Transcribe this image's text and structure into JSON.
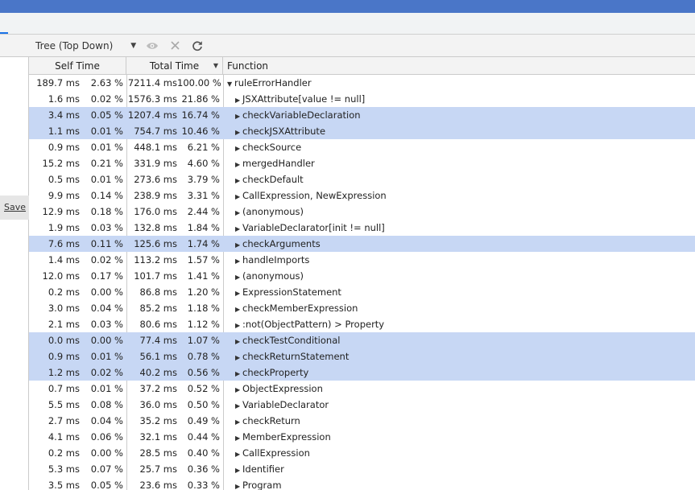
{
  "toolbar": {
    "view_select": "Tree (Top Down)",
    "icons": [
      "dropdown-arrow-icon",
      "eye-icon",
      "close-icon",
      "reload-icon"
    ]
  },
  "left": {
    "save_label": "Save"
  },
  "columns": {
    "self": "Self Time",
    "total": "Total Time",
    "function": "Function"
  },
  "colors": {
    "topbar": "#4a76c8",
    "selection": "#c7d7f4",
    "accent": "#1a73e8"
  },
  "rows": [
    {
      "self_ms": "189.7 ms",
      "self_pct": "2.63 %",
      "total_ms": "7211.4 ms",
      "total_pct": "100.00 %",
      "fn": "ruleErrorHandler",
      "expanded": true,
      "selected": false,
      "level": 0
    },
    {
      "self_ms": "1.6 ms",
      "self_pct": "0.02 %",
      "total_ms": "1576.3 ms",
      "total_pct": "21.86 %",
      "fn": "JSXAttribute[value != null]",
      "expanded": false,
      "selected": false,
      "level": 1
    },
    {
      "self_ms": "3.4 ms",
      "self_pct": "0.05 %",
      "total_ms": "1207.4 ms",
      "total_pct": "16.74 %",
      "fn": "checkVariableDeclaration",
      "expanded": false,
      "selected": true,
      "level": 1
    },
    {
      "self_ms": "1.1 ms",
      "self_pct": "0.01 %",
      "total_ms": "754.7 ms",
      "total_pct": "10.46 %",
      "fn": "checkJSXAttribute",
      "expanded": false,
      "selected": true,
      "level": 1
    },
    {
      "self_ms": "0.9 ms",
      "self_pct": "0.01 %",
      "total_ms": "448.1 ms",
      "total_pct": "6.21 %",
      "fn": "checkSource",
      "expanded": false,
      "selected": false,
      "level": 1
    },
    {
      "self_ms": "15.2 ms",
      "self_pct": "0.21 %",
      "total_ms": "331.9 ms",
      "total_pct": "4.60 %",
      "fn": "mergedHandler",
      "expanded": false,
      "selected": false,
      "level": 1
    },
    {
      "self_ms": "0.5 ms",
      "self_pct": "0.01 %",
      "total_ms": "273.6 ms",
      "total_pct": "3.79 %",
      "fn": "checkDefault",
      "expanded": false,
      "selected": false,
      "level": 1
    },
    {
      "self_ms": "9.9 ms",
      "self_pct": "0.14 %",
      "total_ms": "238.9 ms",
      "total_pct": "3.31 %",
      "fn": "CallExpression, NewExpression",
      "expanded": false,
      "selected": false,
      "level": 1
    },
    {
      "self_ms": "12.9 ms",
      "self_pct": "0.18 %",
      "total_ms": "176.0 ms",
      "total_pct": "2.44 %",
      "fn": "(anonymous)",
      "expanded": false,
      "selected": false,
      "level": 1
    },
    {
      "self_ms": "1.9 ms",
      "self_pct": "0.03 %",
      "total_ms": "132.8 ms",
      "total_pct": "1.84 %",
      "fn": "VariableDeclarator[init != null]",
      "expanded": false,
      "selected": false,
      "level": 1
    },
    {
      "self_ms": "7.6 ms",
      "self_pct": "0.11 %",
      "total_ms": "125.6 ms",
      "total_pct": "1.74 %",
      "fn": "checkArguments",
      "expanded": false,
      "selected": true,
      "level": 1
    },
    {
      "self_ms": "1.4 ms",
      "self_pct": "0.02 %",
      "total_ms": "113.2 ms",
      "total_pct": "1.57 %",
      "fn": "handleImports",
      "expanded": false,
      "selected": false,
      "level": 1
    },
    {
      "self_ms": "12.0 ms",
      "self_pct": "0.17 %",
      "total_ms": "101.7 ms",
      "total_pct": "1.41 %",
      "fn": "(anonymous)",
      "expanded": false,
      "selected": false,
      "level": 1
    },
    {
      "self_ms": "0.2 ms",
      "self_pct": "0.00 %",
      "total_ms": "86.8 ms",
      "total_pct": "1.20 %",
      "fn": "ExpressionStatement",
      "expanded": false,
      "selected": false,
      "level": 1
    },
    {
      "self_ms": "3.0 ms",
      "self_pct": "0.04 %",
      "total_ms": "85.2 ms",
      "total_pct": "1.18 %",
      "fn": "checkMemberExpression",
      "expanded": false,
      "selected": false,
      "level": 1
    },
    {
      "self_ms": "2.1 ms",
      "self_pct": "0.03 %",
      "total_ms": "80.6 ms",
      "total_pct": "1.12 %",
      "fn": ":not(ObjectPattern) > Property",
      "expanded": false,
      "selected": false,
      "level": 1
    },
    {
      "self_ms": "0.0 ms",
      "self_pct": "0.00 %",
      "total_ms": "77.4 ms",
      "total_pct": "1.07 %",
      "fn": "checkTestConditional",
      "expanded": false,
      "selected": true,
      "level": 1
    },
    {
      "self_ms": "0.9 ms",
      "self_pct": "0.01 %",
      "total_ms": "56.1 ms",
      "total_pct": "0.78 %",
      "fn": "checkReturnStatement",
      "expanded": false,
      "selected": true,
      "level": 1
    },
    {
      "self_ms": "1.2 ms",
      "self_pct": "0.02 %",
      "total_ms": "40.2 ms",
      "total_pct": "0.56 %",
      "fn": "checkProperty",
      "expanded": false,
      "selected": true,
      "level": 1
    },
    {
      "self_ms": "0.7 ms",
      "self_pct": "0.01 %",
      "total_ms": "37.2 ms",
      "total_pct": "0.52 %",
      "fn": "ObjectExpression",
      "expanded": false,
      "selected": false,
      "level": 1
    },
    {
      "self_ms": "5.5 ms",
      "self_pct": "0.08 %",
      "total_ms": "36.0 ms",
      "total_pct": "0.50 %",
      "fn": "VariableDeclarator",
      "expanded": false,
      "selected": false,
      "level": 1
    },
    {
      "self_ms": "2.7 ms",
      "self_pct": "0.04 %",
      "total_ms": "35.2 ms",
      "total_pct": "0.49 %",
      "fn": "checkReturn",
      "expanded": false,
      "selected": false,
      "level": 1
    },
    {
      "self_ms": "4.1 ms",
      "self_pct": "0.06 %",
      "total_ms": "32.1 ms",
      "total_pct": "0.44 %",
      "fn": "MemberExpression",
      "expanded": false,
      "selected": false,
      "level": 1
    },
    {
      "self_ms": "0.2 ms",
      "self_pct": "0.00 %",
      "total_ms": "28.5 ms",
      "total_pct": "0.40 %",
      "fn": "CallExpression",
      "expanded": false,
      "selected": false,
      "level": 1
    },
    {
      "self_ms": "5.3 ms",
      "self_pct": "0.07 %",
      "total_ms": "25.7 ms",
      "total_pct": "0.36 %",
      "fn": "Identifier",
      "expanded": false,
      "selected": false,
      "level": 1
    },
    {
      "self_ms": "3.5 ms",
      "self_pct": "0.05 %",
      "total_ms": "23.6 ms",
      "total_pct": "0.33 %",
      "fn": "Program",
      "expanded": false,
      "selected": false,
      "level": 1
    }
  ]
}
